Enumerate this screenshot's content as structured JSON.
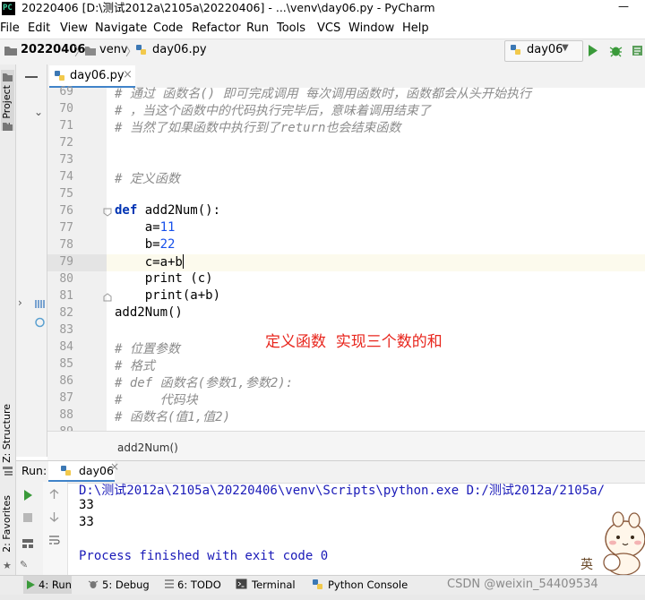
{
  "window": {
    "title": "20220406 [D:\\测试2012a\\2105a\\20220406] - ...\\venv\\day06.py - PyCharm",
    "minimize_glyph": "—"
  },
  "menu": [
    "File",
    "Edit",
    "View",
    "Navigate",
    "Code",
    "Refactor",
    "Run",
    "Tools",
    "VCS",
    "Window",
    "Help"
  ],
  "breadcrumb": {
    "project": "20220406",
    "folder": "venv",
    "file": "day06.py"
  },
  "run_config": {
    "name": "day06"
  },
  "left_panel": {
    "project_label": "1: Project",
    "structure_label": "Z: Structure",
    "favorites_label": "2: Favorites"
  },
  "editor": {
    "tab_label": "day06.py",
    "close_glyph": "×",
    "lines": [
      {
        "n": "69",
        "parts": [
          {
            "t": "cmt",
            "s": "# 通过 函数名() 即可完成调用 每次调用函数时，函数都会从头开始执行"
          }
        ]
      },
      {
        "n": "70",
        "parts": [
          {
            "t": "cmt",
            "s": "# ，当这个函数中的代码执行完毕后，意味着调用结束了"
          }
        ]
      },
      {
        "n": "71",
        "parts": [
          {
            "t": "cmt",
            "s": "# 当然了如果函数中执行到了return也会结束函数"
          }
        ]
      },
      {
        "n": "72",
        "parts": []
      },
      {
        "n": "73",
        "parts": []
      },
      {
        "n": "74",
        "parts": [
          {
            "t": "cmt",
            "s": "# 定义函数"
          }
        ]
      },
      {
        "n": "75",
        "parts": []
      },
      {
        "n": "76",
        "parts": [
          {
            "t": "kw",
            "s": "def "
          },
          {
            "t": "txt",
            "s": "add2Num():"
          }
        ]
      },
      {
        "n": "77",
        "parts": [
          {
            "t": "txt",
            "s": "    a="
          },
          {
            "t": "num",
            "s": "11"
          }
        ]
      },
      {
        "n": "78",
        "parts": [
          {
            "t": "txt",
            "s": "    b="
          },
          {
            "t": "num",
            "s": "22"
          }
        ]
      },
      {
        "n": "79",
        "parts": [
          {
            "t": "txt",
            "s": "    c=a+b"
          },
          {
            "t": "caret",
            "s": ""
          }
        ]
      },
      {
        "n": "80",
        "parts": [
          {
            "t": "txt",
            "s": "    print (c)"
          }
        ]
      },
      {
        "n": "81",
        "parts": [
          {
            "t": "txt",
            "s": "    print(a+b)"
          }
        ]
      },
      {
        "n": "82",
        "parts": [
          {
            "t": "txt",
            "s": "add2Num()"
          }
        ]
      },
      {
        "n": "83",
        "parts": []
      },
      {
        "n": "84",
        "parts": [
          {
            "t": "cmt",
            "s": "# 位置参数"
          }
        ]
      },
      {
        "n": "85",
        "parts": [
          {
            "t": "cmt",
            "s": "# 格式"
          }
        ]
      },
      {
        "n": "86",
        "parts": [
          {
            "t": "cmt",
            "s": "# def 函数名(参数1,参数2):"
          }
        ]
      },
      {
        "n": "87",
        "parts": [
          {
            "t": "cmt",
            "s": "#     代码块"
          }
        ]
      },
      {
        "n": "88",
        "parts": [
          {
            "t": "cmt",
            "s": "# 函数名(值1,值2)"
          }
        ]
      },
      {
        "n": "89",
        "parts": []
      }
    ],
    "annotation": "定义函数  实现三个数的和",
    "footer_breadcrumb": "add2Num()"
  },
  "run_panel": {
    "label": "Run:",
    "tab_label": "day06",
    "output": [
      "D:\\测试2012a\\2105a\\20220406\\venv\\Scripts\\python.exe D:/测试2012a/2105a/",
      "33",
      "33",
      "",
      "Process finished with exit code 0"
    ]
  },
  "bottom_tabs": [
    "4: Run",
    "5: Debug",
    "6: TODO",
    "Terminal",
    "Python Console"
  ],
  "watermark": "CSDN @weixin_54409534",
  "mascot_badge": "英",
  "colors": {
    "keyword": "#0033b3",
    "number": "#1750eb",
    "comment": "#8c8c8c",
    "annotation": "#e8261d",
    "run_green": "#3a9a3a"
  }
}
